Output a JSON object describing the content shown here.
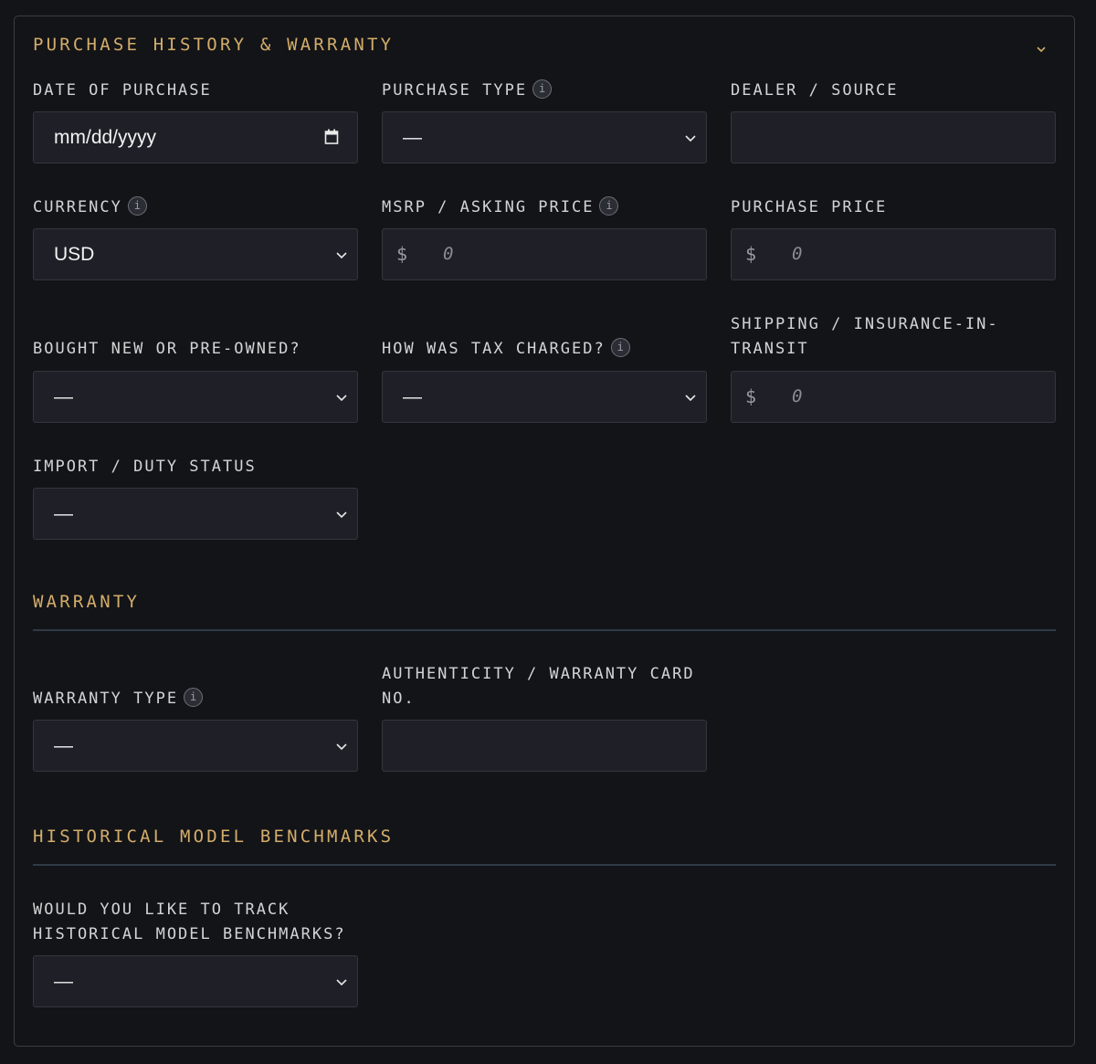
{
  "section": {
    "title": "PURCHASE HISTORY & WARRANTY"
  },
  "fields": {
    "date_of_purchase": {
      "label": "DATE OF PURCHASE",
      "placeholder": "mm/dd/yyyy"
    },
    "purchase_type": {
      "label": "PURCHASE TYPE",
      "value": "—"
    },
    "dealer_source": {
      "label": "DEALER / SOURCE",
      "value": ""
    },
    "currency": {
      "label": "CURRENCY",
      "value": "USD"
    },
    "msrp": {
      "label": "MSRP / ASKING PRICE",
      "prefix": "$",
      "placeholder": "0"
    },
    "purchase_price": {
      "label": "PURCHASE PRICE",
      "prefix": "$",
      "placeholder": "0"
    },
    "condition": {
      "label": "BOUGHT NEW OR PRE-OWNED?",
      "value": "—"
    },
    "tax": {
      "label": "HOW WAS TAX CHARGED?",
      "value": "—"
    },
    "shipping": {
      "label": "SHIPPING / INSURANCE-IN-TRANSIT",
      "prefix": "$",
      "placeholder": "0"
    },
    "import_duty": {
      "label": "IMPORT / DUTY STATUS",
      "value": "—"
    }
  },
  "warranty": {
    "title": "WARRANTY",
    "type": {
      "label": "WARRANTY TYPE",
      "value": "—"
    },
    "card_no": {
      "label": "AUTHENTICITY / WARRANTY CARD NO.",
      "value": ""
    }
  },
  "benchmarks": {
    "title": "HISTORICAL MODEL BENCHMARKS",
    "track": {
      "label": "WOULD YOU LIKE TO TRACK HISTORICAL MODEL BENCHMARKS?",
      "value": "—"
    }
  },
  "icons": {
    "info": "i",
    "collapse": "chevron-down-icon",
    "select_arrow": "chevron-down-icon",
    "calendar": "calendar-icon"
  },
  "colors": {
    "accent": "#d3ad6a",
    "background": "#131418",
    "field_bg": "#1f2027"
  }
}
